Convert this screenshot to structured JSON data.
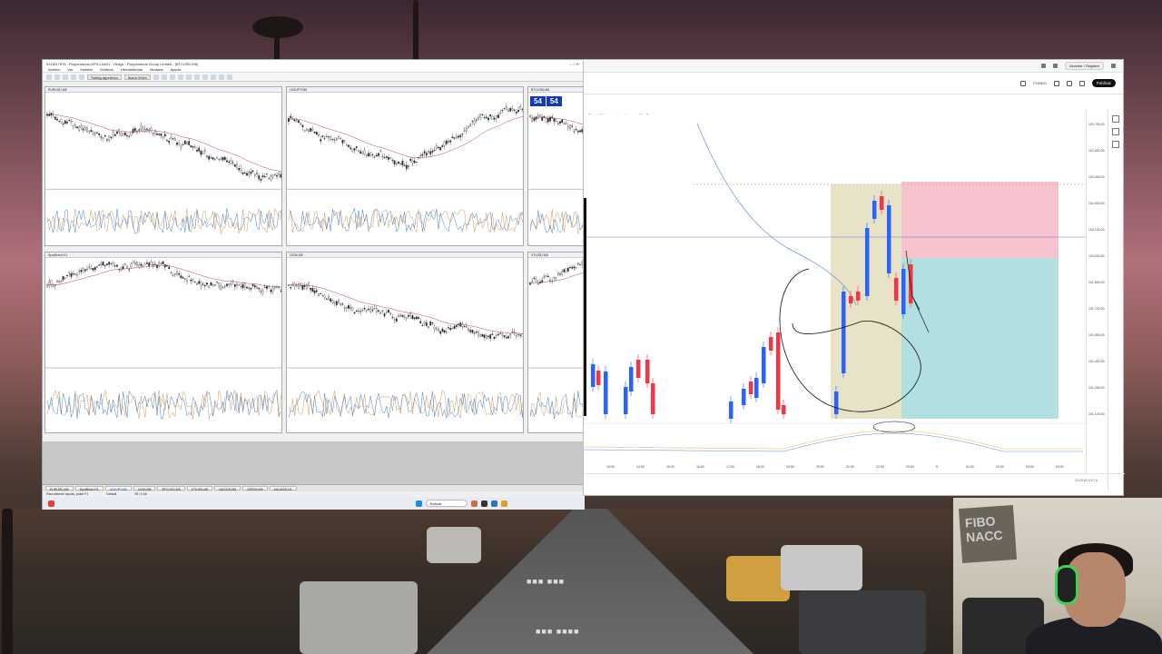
{
  "mt5": {
    "title": "5111817675 - Pepperstone-MT5-Live01 - Hedge - Pepperstone Group Limited - [BTCUSD,M5]",
    "menu": [
      "Archivo",
      "Ver",
      "Insertar",
      "Gráficos",
      "Herramientas",
      "Ventana",
      "Ayuda"
    ],
    "toolbar": [
      "Trading algorítmico",
      "Nueva Orden"
    ],
    "charts": [
      {
        "header": "EURUSD,M5"
      },
      {
        "header": "USDJPY,M5"
      },
      {
        "header": "BTCUSD,M5"
      },
      {
        "header": "SpotBrent,H1"
      },
      {
        "header": "US30,M5"
      },
      {
        "header": "XTIUSD,M5"
      }
    ],
    "one_click": {
      "bid": "54",
      "ask": "54"
    },
    "tabs": [
      "EURUSD,M5",
      "SpotBrent,H1",
      "USDJPY,M5",
      "US30,M5",
      "BTCUSD,M5",
      "XTIUSD,M5",
      "NAS100,M5",
      "GER40,M5",
      "XAUUSD,H1"
    ],
    "status": [
      "Para obtener Ayuda, pulse F1",
      "Default",
      "99 / 0 kb"
    ],
    "taskbar": {
      "search_placeholder": "Buscar"
    }
  },
  "tv": {
    "legend": "Bitcoin/Dólar estadounidense · 15 · Pepperstone",
    "sell_price": "102,091.57",
    "buy_price": "102,097.57",
    "fondo": "FONDO",
    "publish": "Publicar",
    "account_btn": "Acceder / Registro",
    "prices": [
      "102,750.00",
      "102,600.00",
      "102,450.00",
      "102,300.00",
      "102,150.00",
      "102,000.00",
      "101,850.00",
      "101,700.00",
      "101,550.00",
      "101,400.00",
      "101,250.00",
      "101,100.00"
    ],
    "times": [
      "13:00",
      "14:00",
      "15:00",
      "16:00",
      "17:00",
      "18:00",
      "19:00",
      "20:00",
      "21:00",
      "22:00",
      "23:00",
      "5",
      "01:00",
      "02:00",
      "03:00",
      "04:00"
    ],
    "clock": "23:43:50 UTC-5"
  },
  "cam": {
    "sign_text": "FIBO NACC"
  },
  "colors": {
    "bull": "#2962ff",
    "bear": "#f23645",
    "target_zone": "#b2e0e0",
    "stop_zone": "#f7c3cf",
    "highlight": "#d8cfa0"
  }
}
